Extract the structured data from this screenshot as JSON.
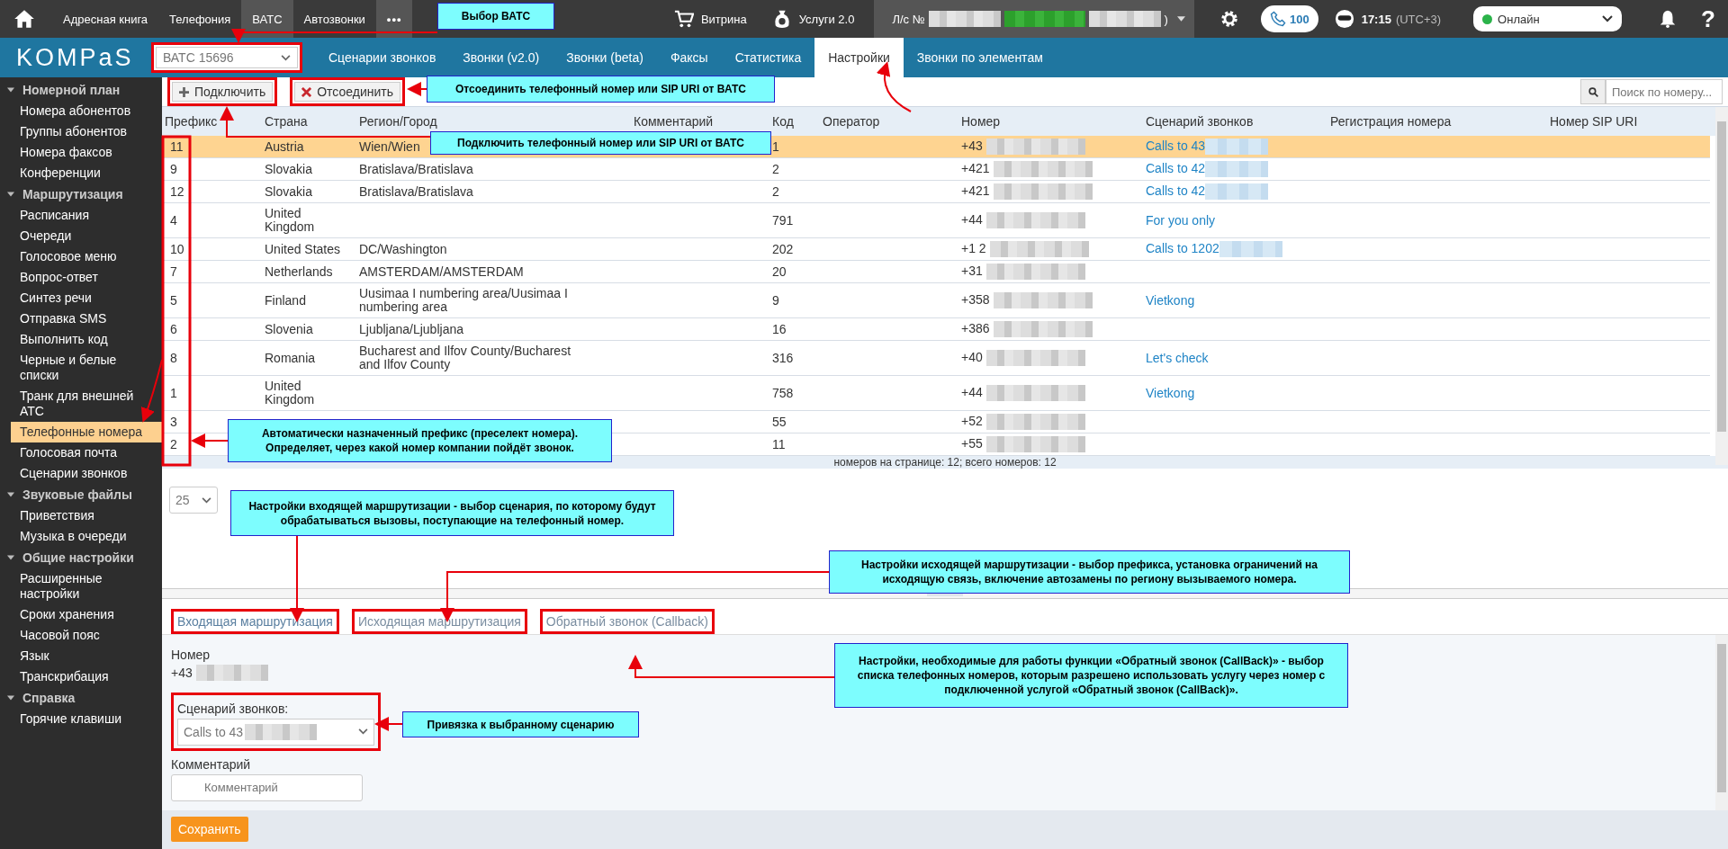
{
  "topbar": {
    "items": [
      {
        "label": "Адресная книга",
        "selected": false
      },
      {
        "label": "Телефония",
        "selected": false
      },
      {
        "label": "ВАТС",
        "selected": true
      },
      {
        "label": "Автозвонки",
        "selected": false
      }
    ],
    "more": "•••",
    "shop": "Витрина",
    "services": "Услуги 2.0",
    "account_prefix": "Л/с №",
    "account_suffix": ")",
    "calls": "100",
    "time": "17:15",
    "timezone": "(UTC+3)",
    "status": "Онлайн",
    "help": "?"
  },
  "nav": {
    "logo": "KOMPaS",
    "pbx": "ВАТС 15696",
    "tabs": [
      {
        "label": "Сценарии звонков",
        "selected": false
      },
      {
        "label": "Звонки (v2.0)",
        "selected": false
      },
      {
        "label": "Звонки (beta)",
        "selected": false
      },
      {
        "label": "Факсы",
        "selected": false
      },
      {
        "label": "Статистика",
        "selected": false
      },
      {
        "label": "Настройки",
        "selected": true
      },
      {
        "label": "Звонки по элементам",
        "selected": false
      }
    ]
  },
  "sidebar": {
    "sections": [
      {
        "label": "Номерной план",
        "expanded": true,
        "children": [
          {
            "label": "Номера абонентов",
            "selected": false
          },
          {
            "label": "Группы абонентов",
            "selected": false
          },
          {
            "label": "Номера факсов",
            "selected": false
          },
          {
            "label": "Конференции",
            "selected": false
          }
        ]
      },
      {
        "label": "Маршрутизация",
        "expanded": true,
        "children": [
          {
            "label": "Расписания",
            "selected": false
          },
          {
            "label": "Очереди",
            "selected": false
          },
          {
            "label": "Голосовое меню",
            "selected": false
          },
          {
            "label": "Вопрос-ответ",
            "selected": false
          },
          {
            "label": "Синтез речи",
            "selected": false
          },
          {
            "label": "Отправка SMS",
            "selected": false
          },
          {
            "label": "Выполнить код",
            "selected": false
          },
          {
            "label": "Черные и белые списки",
            "selected": false
          },
          {
            "label": "Транк для внешней АТС",
            "selected": false
          },
          {
            "label": "Телефонные номера",
            "selected": true
          },
          {
            "label": "Голосовая почта",
            "selected": false
          },
          {
            "label": "Сценарии звонков",
            "selected": false
          }
        ]
      },
      {
        "label": "Звуковые файлы",
        "expanded": true,
        "children": [
          {
            "label": "Приветствия",
            "selected": false
          },
          {
            "label": "Музыка в очереди",
            "selected": false
          }
        ]
      },
      {
        "label": "Общие настройки",
        "expanded": true,
        "children": [
          {
            "label": "Расширенные настройки",
            "selected": false
          },
          {
            "label": "Сроки хранения",
            "selected": false
          },
          {
            "label": "Часовой пояс",
            "selected": false
          },
          {
            "label": "Язык",
            "selected": false
          },
          {
            "label": "Транскрибация",
            "selected": false
          }
        ]
      },
      {
        "label": "Справка",
        "expanded": true,
        "children": [
          {
            "label": "Горячие клавиши",
            "selected": false
          }
        ]
      }
    ]
  },
  "toolbar": {
    "connect": "Подключить",
    "disconnect": "Отсоединить",
    "search_placeholder": "Поиск по номеру..."
  },
  "table": {
    "columns": [
      "Префикс",
      "Страна",
      "Регион/Город",
      "Комментарий",
      "Код",
      "Оператор",
      "Номер",
      "Сценарий звонков",
      "Регистрация номера",
      "Номер SIP URI"
    ],
    "rows": [
      {
        "prefix": "11",
        "country": "Austria",
        "region": "Wien/Wien",
        "code": "1",
        "number": "+43",
        "scenario": "Calls to 43",
        "scenario_blurred": true,
        "selected": true
      },
      {
        "prefix": "9",
        "country": "Slovakia",
        "region": "Bratislava/Bratislava",
        "code": "2",
        "number": "+421",
        "scenario": "Calls to 42",
        "scenario_blurred": true,
        "selected": false
      },
      {
        "prefix": "12",
        "country": "Slovakia",
        "region": "Bratislava/Bratislava",
        "code": "2",
        "number": "+421",
        "scenario": "Calls to 42",
        "scenario_blurred": true,
        "selected": false
      },
      {
        "prefix": "4",
        "country": "United Kingdom",
        "region": "",
        "code": "791",
        "number": "+44",
        "scenario": "For you only",
        "scenario_blurred": false,
        "selected": false
      },
      {
        "prefix": "10",
        "country": "United States",
        "region": "DC/Washington",
        "code": "202",
        "number": "+1 2",
        "scenario": "Calls to 1202",
        "scenario_blurred": true,
        "selected": false
      },
      {
        "prefix": "7",
        "country": "Netherlands",
        "region": "AMSTERDAM/AMSTERDAM",
        "code": "20",
        "number": "+31",
        "scenario": "",
        "scenario_blurred": false,
        "selected": false
      },
      {
        "prefix": "5",
        "country": "Finland",
        "region": "Uusimaa I numbering area/Uusimaa I numbering area",
        "code": "9",
        "number": "+358",
        "scenario": "Vietkong",
        "scenario_blurred": false,
        "selected": false
      },
      {
        "prefix": "6",
        "country": "Slovenia",
        "region": "Ljubljana/Ljubljana",
        "code": "16",
        "number": "+386",
        "scenario": "",
        "scenario_blurred": false,
        "selected": false
      },
      {
        "prefix": "8",
        "country": "Romania",
        "region": "Bucharest and Ilfov County/Bucharest and Ilfov County",
        "code": "316",
        "number": "+40",
        "scenario": "Let's check",
        "scenario_blurred": false,
        "selected": false
      },
      {
        "prefix": "1",
        "country": "United Kingdom",
        "region": "",
        "code": "758",
        "number": "+44",
        "scenario": "Vietkong",
        "scenario_blurred": false,
        "selected": false
      },
      {
        "prefix": "3",
        "country": "",
        "region": "",
        "code": "55",
        "number": "+52",
        "scenario": "",
        "scenario_blurred": false,
        "selected": false
      },
      {
        "prefix": "2",
        "country": "",
        "region": "",
        "code": "11",
        "number": "+55",
        "scenario": "",
        "scenario_blurred": false,
        "selected": false
      }
    ],
    "footer": "номеров на странице: 12; всего номеров: 12"
  },
  "page_size": "25",
  "details": {
    "tabs": [
      {
        "label": "Входящая маршрутизация",
        "selected": true
      },
      {
        "label": "Исходящая маршрутизация",
        "selected": false
      },
      {
        "label": "Обратный звонок (Callback)",
        "selected": false
      }
    ],
    "number_label": "Номер",
    "number": "+43",
    "scenario_label": "Сценарий звонков:",
    "scenario": "Calls to 43",
    "comment_label": "Комментарий",
    "comment_placeholder": "Комментарий",
    "save": "Сохранить"
  },
  "callouts": [
    "Выбор ВАТС",
    "Отсоединить телефонный номер или SIP URI от ВАТС",
    "Подключить телефонный номер или SIP URI от ВАТС",
    "Автоматически назначенный префикс (преселект номера). Определяет, через какой номер компании пойдёт звонок.",
    "Настройки входящей маршрутизации - выбор сценария, по которому будут обрабатываться вызовы, поступающие на телефонный номер.",
    "Настройки исходящей маршрутизации - выбор префикса, установка ограничений на исходящую связь, включение автозамены по региону вызываемого номера.",
    "Настройки, необходимые для работы функции «Обратный звонок (CallBack)» - выбор списка телефонных номеров, которым разрешено использовать услугу через номер с подключенной услугой «Обратный звонок (CallBack)».",
    "Привязка к выбранному сценарию"
  ]
}
